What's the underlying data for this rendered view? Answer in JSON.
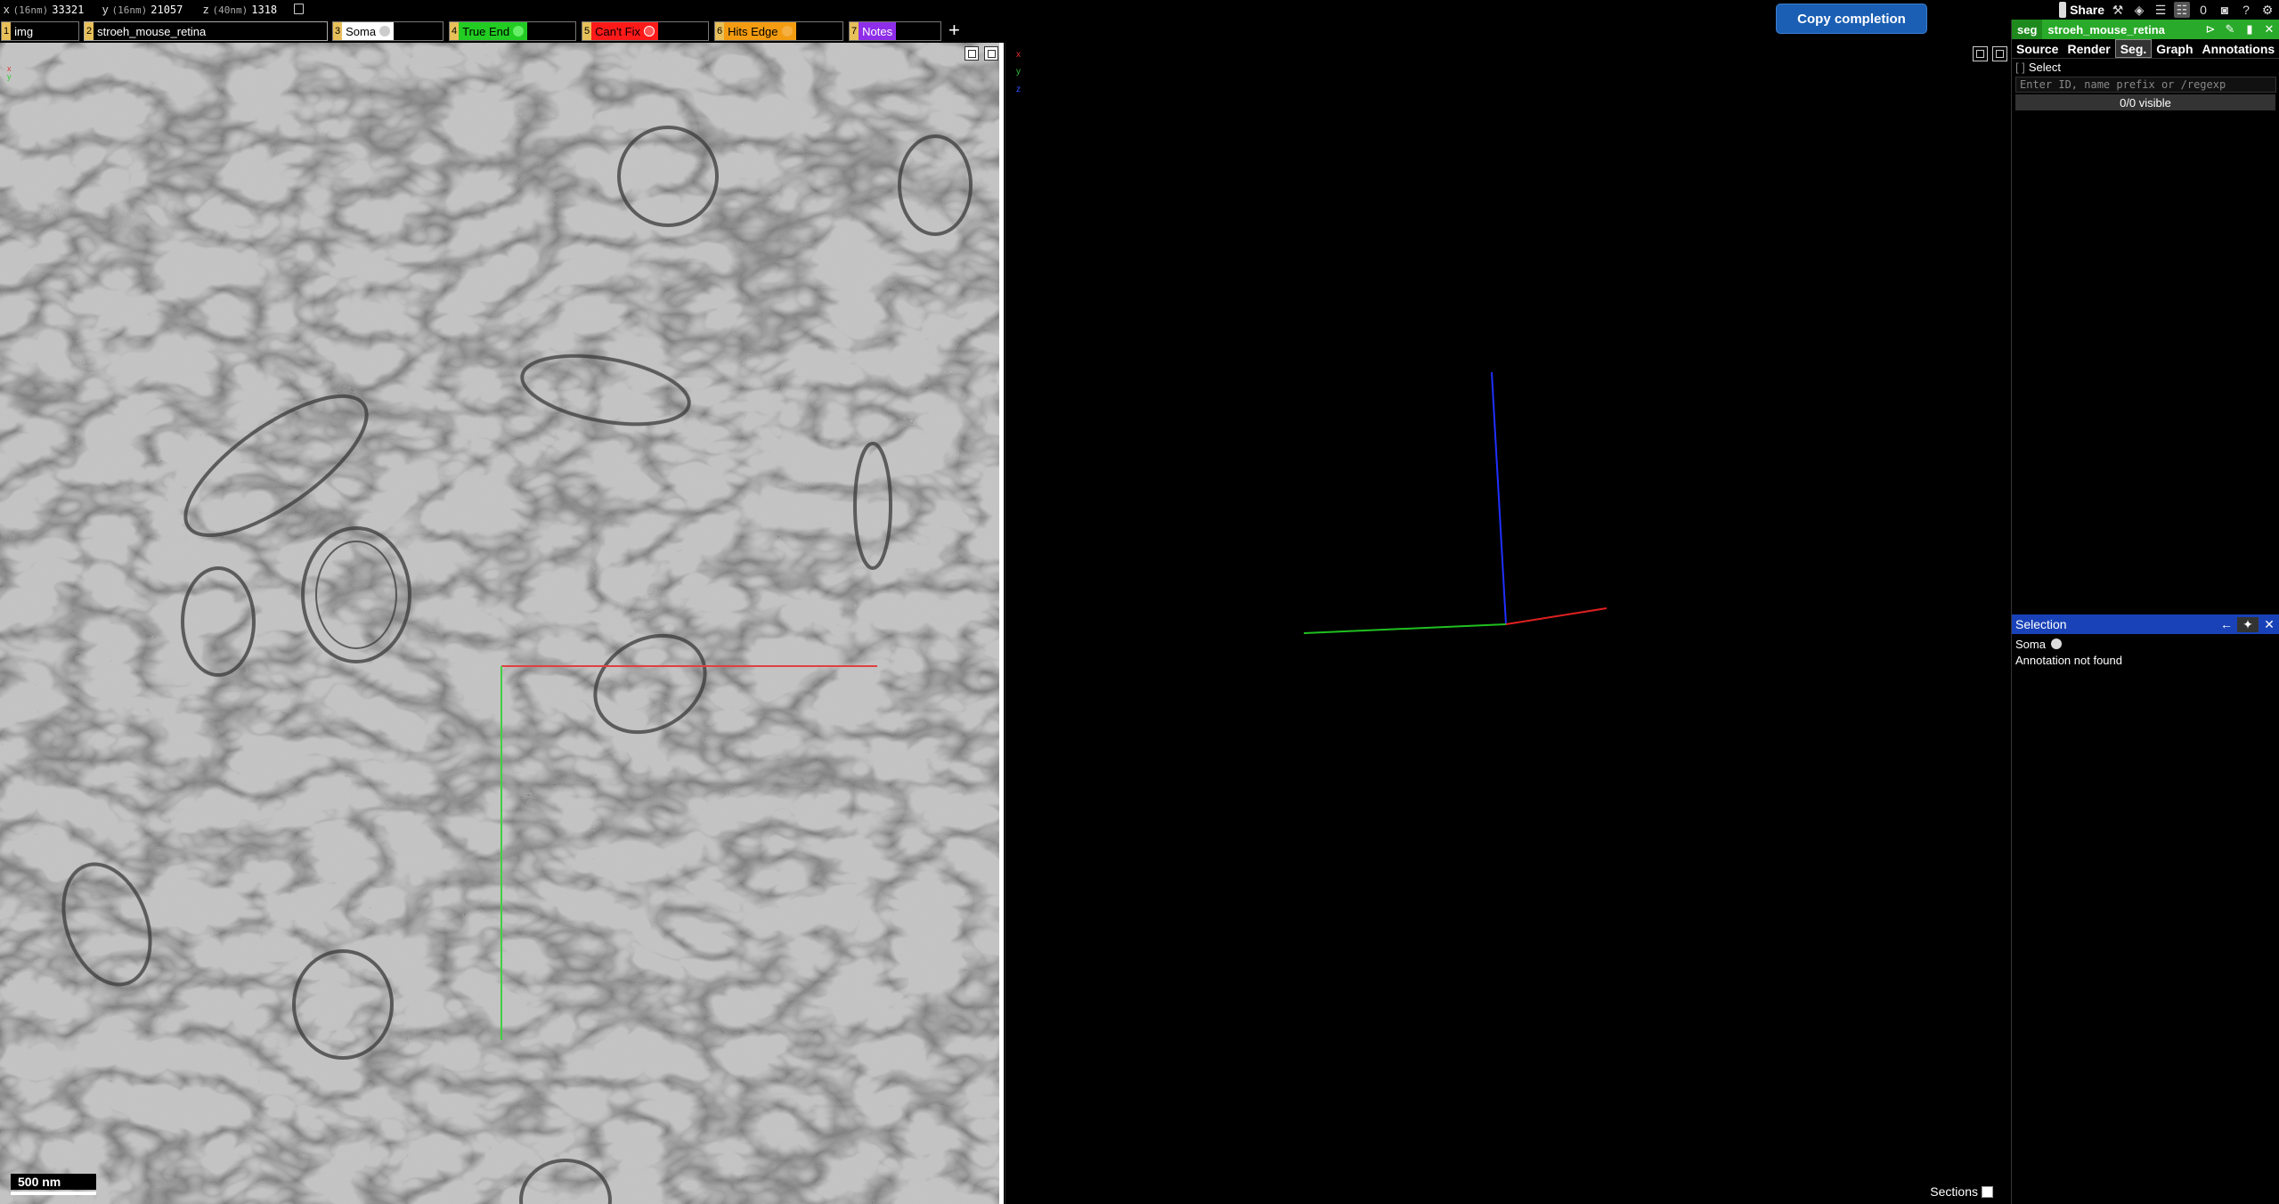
{
  "coords": {
    "x": {
      "label": "x",
      "unit": "(16nm)",
      "value": "33321"
    },
    "y": {
      "label": "y",
      "unit": "(16nm)",
      "value": "21057"
    },
    "z": {
      "label": "z",
      "unit": "(40nm)",
      "value": "1318"
    }
  },
  "copy_completion_label": "Copy completion",
  "toolbar": {
    "share_label": "Share",
    "counter": "0",
    "help": "?"
  },
  "layers": [
    {
      "num": "1",
      "name": "img",
      "color": "#000000",
      "swatch": null
    },
    {
      "num": "2",
      "name": "stroeh_mouse_retina",
      "color": "#000000",
      "swatch": null
    },
    {
      "num": "3",
      "name": "Soma",
      "color": "#ffffff",
      "swatch": "#dddddd"
    },
    {
      "num": "4",
      "name": "True End",
      "color": "#22cc22",
      "swatch": "#22cc22"
    },
    {
      "num": "5",
      "name": "Can't Fix",
      "color": "#ff2222",
      "swatch": "#ff2222"
    },
    {
      "num": "6",
      "name": "Hits Edge",
      "color": "#f39c12",
      "swatch": "#f39c12"
    },
    {
      "num": "7",
      "name": "Notes",
      "color": "#8e2ee8",
      "swatch": null
    }
  ],
  "add_layer": "+",
  "scale_bar": "500 nm",
  "axes": {
    "x": "x",
    "y": "y",
    "z": "z"
  },
  "sections_label": "Sections",
  "side_panel": {
    "layer_kind": "seg",
    "layer_name": "stroeh_mouse_retina",
    "tabs": [
      "Source",
      "Render",
      "Seg.",
      "Graph",
      "Annotations"
    ],
    "active_tab": "Seg.",
    "select_key": "[ ]",
    "select_label": "Select",
    "id_placeholder": "Enter ID, name prefix or /regexp",
    "visible_count": "0/0 visible"
  },
  "selection": {
    "title": "Selection",
    "layer": "Soma",
    "message": "Annotation not found"
  },
  "colors": {
    "seg_header": "#2aaa2a",
    "selection_header": "#1942b8",
    "copy_button": "#1a5fb4"
  }
}
